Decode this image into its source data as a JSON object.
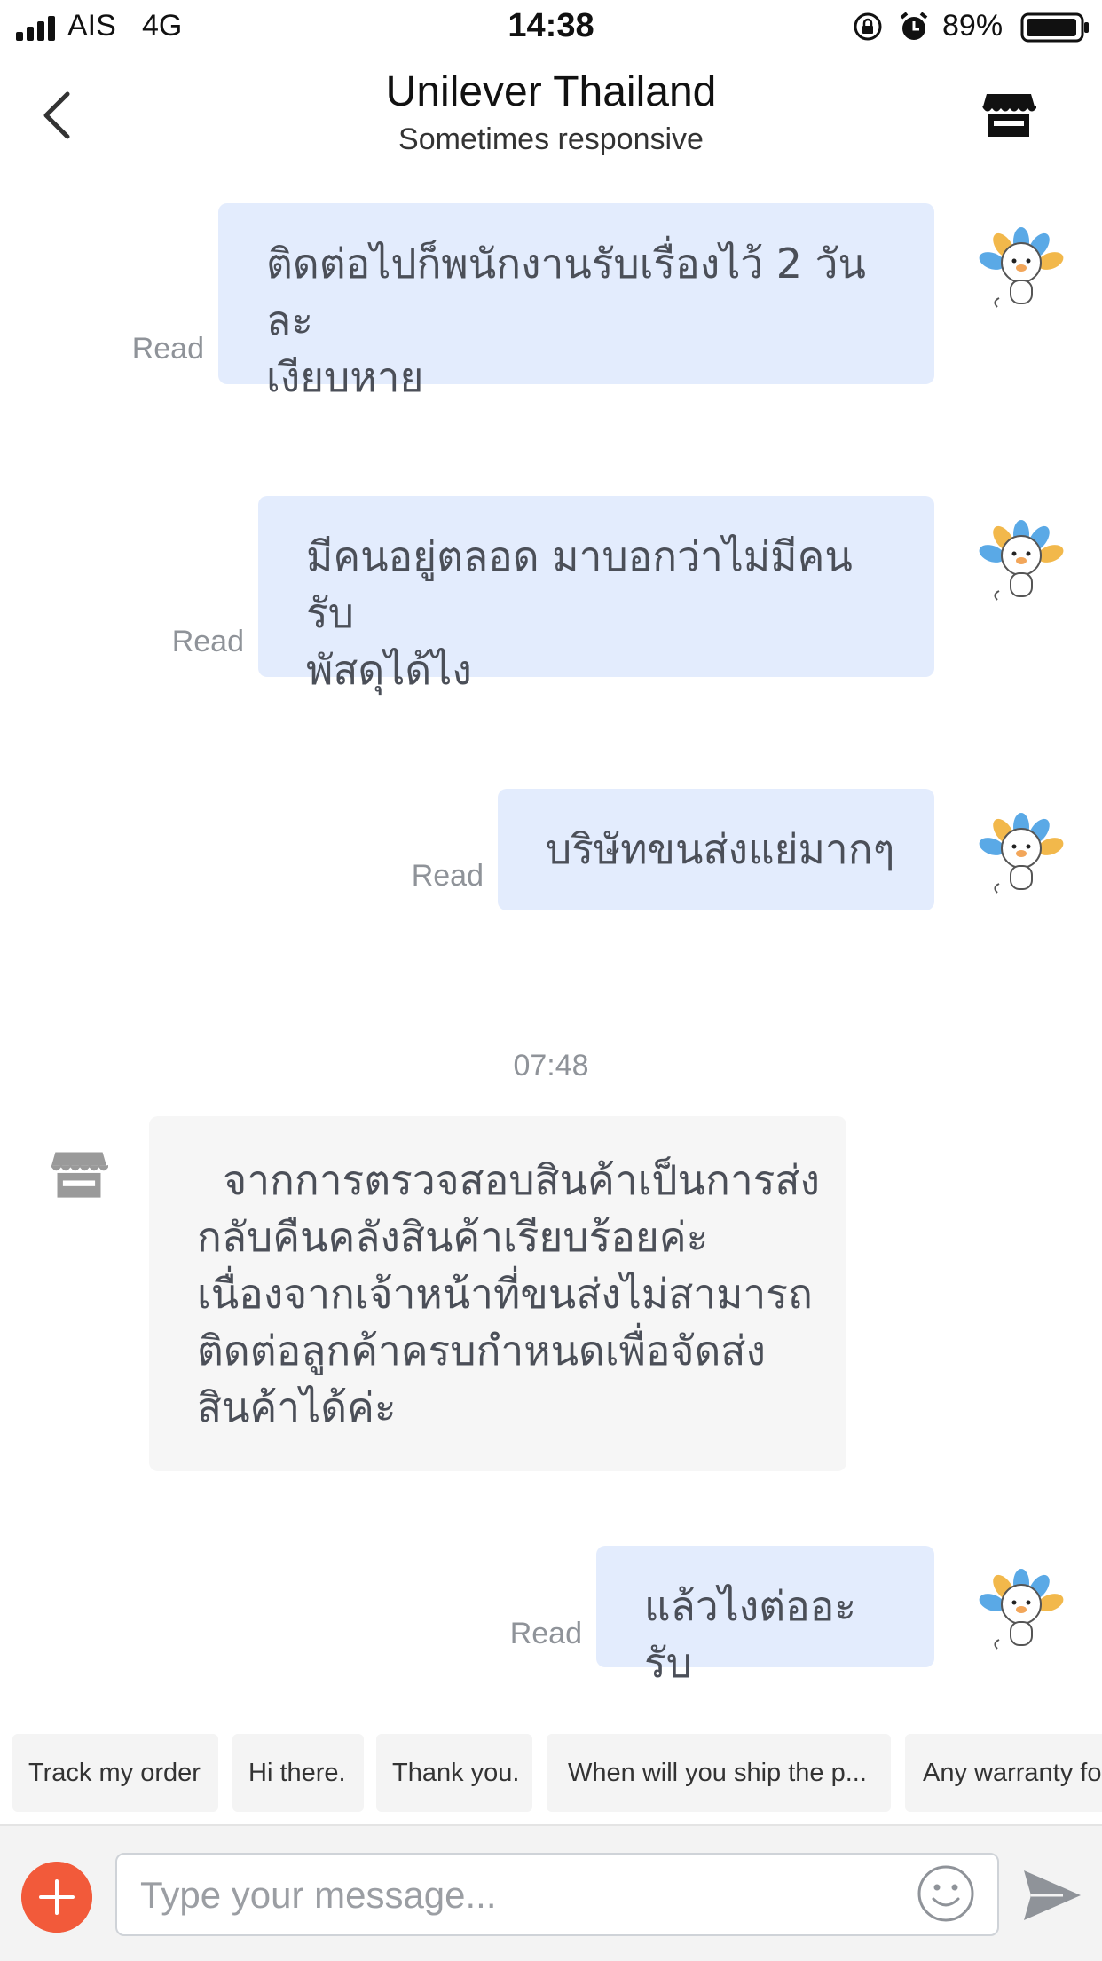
{
  "status_bar": {
    "carrier": "AIS",
    "network": "4G",
    "time": "14:38",
    "battery": "89%",
    "icons": [
      "signal-icon",
      "orientation-lock-icon",
      "alarm-icon",
      "battery-icon"
    ]
  },
  "header": {
    "title": "Unilever Thailand",
    "subtitle": "Sometimes responsive",
    "icons": [
      "back-chevron-icon",
      "store-icon"
    ]
  },
  "messages": [
    {
      "direction": "out",
      "lines": [
        "ติดต่อไปก็พนักงานรับเรื่องไว้ 2 วันละ",
        "เงียบหาย"
      ],
      "status": "Read"
    },
    {
      "direction": "out",
      "lines": [
        "มีคนอยู่ตลอด มาบอกว่าไม่มีคนรับ",
        "พัสดุได้ไง"
      ],
      "status": "Read"
    },
    {
      "direction": "out",
      "lines": [
        "บริษัทขนส่งแย่มากๆ"
      ],
      "status": "Read"
    },
    {
      "direction": "separator",
      "time": "07:48"
    },
    {
      "direction": "in",
      "lines": [
        "  จากการตรวจสอบสินค้าเป็นการส่ง",
        "กลับคืนคลังสินค้าเรียบร้อยค่ะ",
        "เนื่องจากเจ้าหน้าที่ขนส่งไม่สามารถ",
        "ติดต่อลูกค้าครบกำหนดเพื่อจัดส่ง",
        "สินค้าได้ค่ะ"
      ]
    },
    {
      "direction": "out",
      "lines": [
        "แล้วไงต่ออะรับ"
      ],
      "status": "Read"
    }
  ],
  "quick_replies": [
    "Track my order",
    "Hi there.",
    "Thank you.",
    "When will you ship the p...",
    "Any warranty fo"
  ],
  "composer": {
    "placeholder": "Type your message...",
    "icons": [
      "add-icon",
      "emoji-icon",
      "send-icon"
    ]
  },
  "colors": {
    "outgoing_bubble": "#e3ecfd",
    "incoming_bubble": "#f6f6f6",
    "add_button": "#f25a3a",
    "read_text": "#8f9399"
  }
}
